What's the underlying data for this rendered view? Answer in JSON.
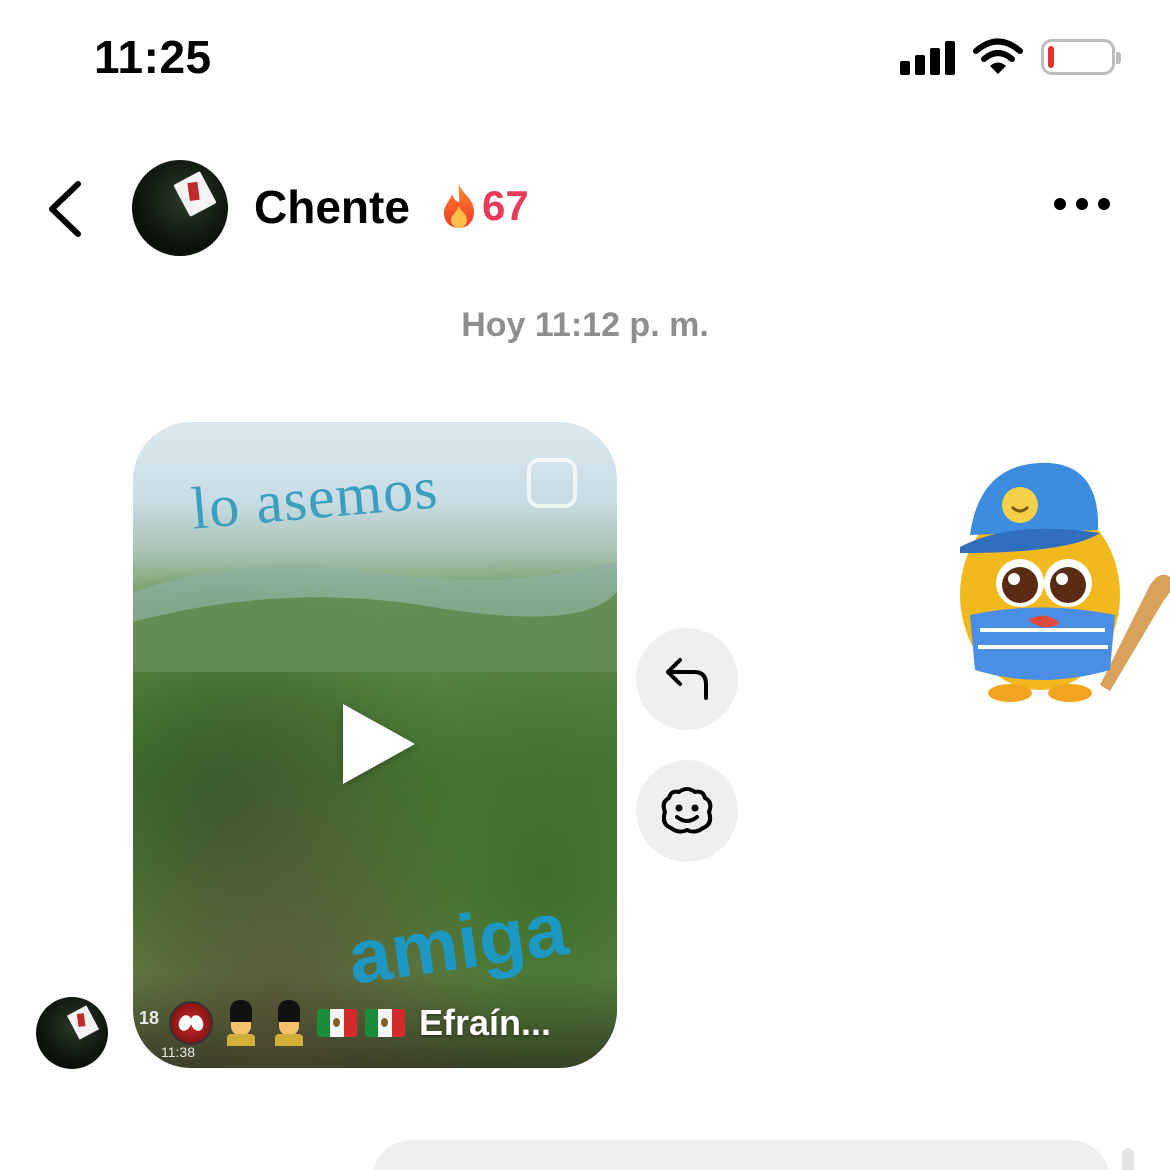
{
  "status_bar": {
    "time": "11:25",
    "icons": [
      "cellular-signal-icon",
      "wifi-icon",
      "battery-low-icon"
    ],
    "battery_color": "#e8322b"
  },
  "header": {
    "back_icon": "chevron-left-icon",
    "contact_name": "Chente",
    "streak_icon": "fire-icon",
    "streak_count": "67",
    "streak_color": "#ea3a5a",
    "more_icon": "more-horizontal-icon"
  },
  "chat": {
    "timestamp": "Hoy 11:12 p. m.",
    "video_message": {
      "caption_top": "lo asemos",
      "caption_bottom": "amiga",
      "play_icon": "play-icon",
      "footer_name": "Efraín...",
      "footer_number": "18",
      "footer_time": "11:38",
      "footer_emojis": [
        "spiderman-emoji",
        "guard-emoji",
        "guard-emoji",
        "mexico-flag-emoji",
        "mexico-flag-emoji"
      ]
    },
    "actions": {
      "reply_icon": "reply-icon",
      "react_icon": "emoji-react-icon"
    },
    "sticker": "baseball-mascot-sticker"
  }
}
